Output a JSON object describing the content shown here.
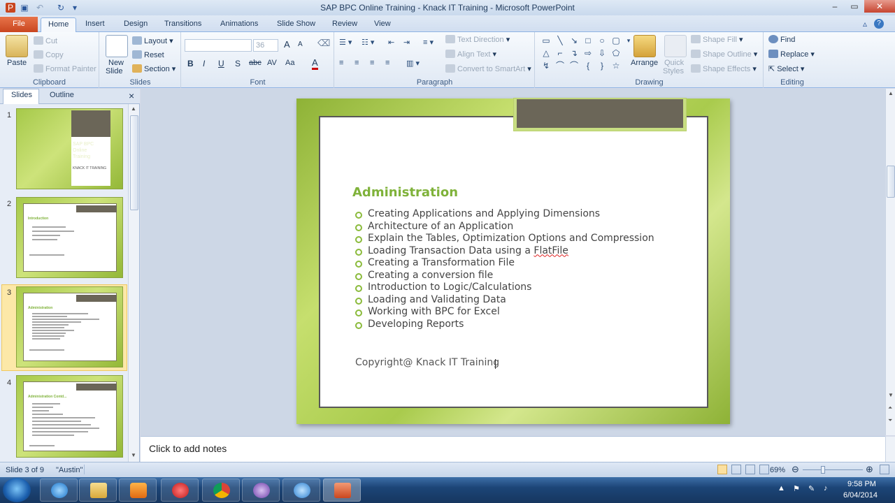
{
  "window": {
    "title": "SAP BPC  Online Training - Knack IT Training  -  Microsoft PowerPoint",
    "min": "–",
    "max": "▭",
    "close": "✕"
  },
  "tabs": [
    "File",
    "Home",
    "Insert",
    "Design",
    "Transitions",
    "Animations",
    "Slide Show",
    "Review",
    "View"
  ],
  "ribbon": {
    "clipboard": {
      "paste": "Paste",
      "cut": "Cut",
      "copy": "Copy",
      "format_painter": "Format Painter",
      "label": "Clipboard"
    },
    "slides": {
      "new_slide": "New",
      "new_slide2": "Slide",
      "layout": "Layout",
      "reset": "Reset",
      "section": "Section",
      "label": "Slides"
    },
    "font": {
      "size": "36",
      "label": "Font",
      "bold": "B",
      "italic": "I",
      "underline": "U",
      "shadow": "S",
      "strike": "abc",
      "spacing": "AV",
      "case": "Aa",
      "color": "A",
      "grow": "A",
      "shrink": "A"
    },
    "paragraph": {
      "text_direction": "Text Direction",
      "align_text": "Align Text",
      "convert_smartart": "Convert to SmartArt",
      "label": "Paragraph"
    },
    "drawing": {
      "arrange": "Arrange",
      "quick_styles": "Quick",
      "quick_styles2": "Styles",
      "shape_fill": "Shape Fill",
      "shape_outline": "Shape Outline",
      "shape_effects": "Shape Effects",
      "label": "Drawing"
    },
    "editing": {
      "find": "Find",
      "replace": "Replace",
      "select": "Select",
      "label": "Editing"
    }
  },
  "left_pane": {
    "tab_slides": "Slides",
    "tab_outline": "Outline",
    "close": "×",
    "slide_numbers": [
      "1",
      "2",
      "3",
      "4"
    ],
    "thumb1_title": "SAP BPC Online Training",
    "thumb1_sub": "KNACK IT TRAINING",
    "thumb2_title": "Introduction",
    "thumb3_title": "Administration",
    "thumb4_title": "Administration  Contd..."
  },
  "slide": {
    "title": "Administration",
    "bullets": [
      "Creating Applications and Applying Dimensions",
      "Architecture of an Application",
      "Explain the Tables, Optimization Options and Compression",
      "Loading Transaction Data using a ",
      "Creating a Transformation File",
      "Creating a conversion file",
      "Introduction to Logic/Calculations",
      "Loading and Validating Data",
      "Working with BPC for Excel",
      "Developing Reports"
    ],
    "spell_word": "FlatFile",
    "copyright": "Copyright@ Knack IT Training"
  },
  "notes": {
    "placeholder": "Click to add notes"
  },
  "status": {
    "slide_info": "Slide 3 of 9",
    "theme": "\"Austin\"",
    "zoom": "69%"
  },
  "tray": {
    "time": "9:58 PM",
    "date": "6/04/2014"
  },
  "colors": {
    "accent_green": "#7fb23a",
    "file_tab": "#c9461f",
    "ribbon_border": "#8db2e3"
  }
}
